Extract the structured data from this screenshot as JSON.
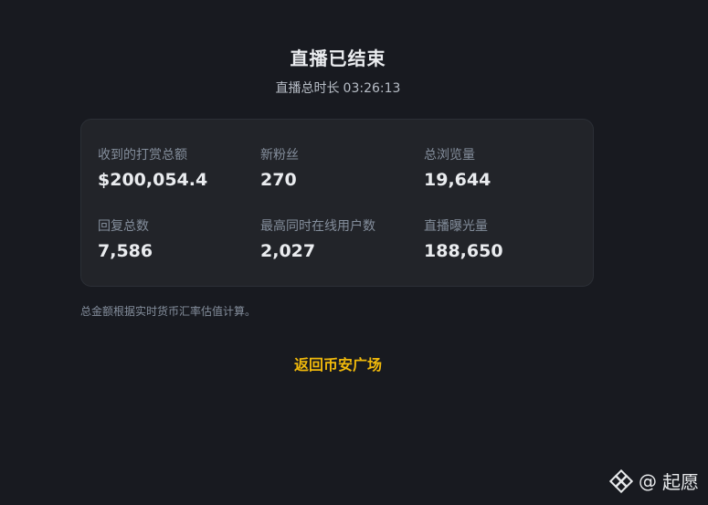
{
  "header": {
    "title": "直播已结束",
    "duration_label": "直播总时长",
    "duration_value": "03:26:13"
  },
  "stats": [
    {
      "label": "收到的打赏总额",
      "value": "$200,054.4"
    },
    {
      "label": "新粉丝",
      "value": "270"
    },
    {
      "label": "总浏览量",
      "value": "19,644"
    },
    {
      "label": "回复总数",
      "value": "7,586"
    },
    {
      "label": "最高同时在线用户数",
      "value": "2,027"
    },
    {
      "label": "直播曝光量",
      "value": "188,650"
    }
  ],
  "note": "总金额根据实时货币汇率估值计算。",
  "back_link": "返回币安广场",
  "watermark": {
    "at": "@",
    "name": "起愿",
    "icon": "binance-logo-icon"
  },
  "colors": {
    "background": "#181a20",
    "card": "#222429",
    "accent": "#f0b90b",
    "muted": "#848e9c"
  }
}
